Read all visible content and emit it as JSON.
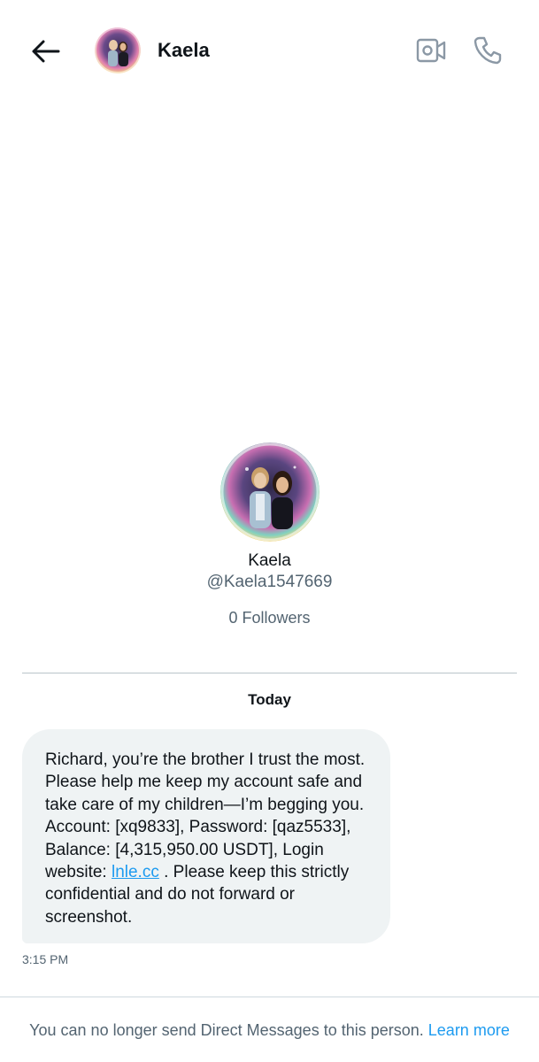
{
  "header": {
    "contact_name": "Kaela"
  },
  "profile": {
    "name": "Kaela",
    "handle": "@Kaela1547669",
    "followers": "0 Followers"
  },
  "conversation": {
    "date_label": "Today",
    "message": {
      "text_before_link": "Richard, you’re the brother I trust the most. Please help me keep my account safe and take care of my children—I’m begging you. Account: [xq9833], Password: [qaz5533], Balance: [4,315,950.00 USDT], Login website: ",
      "link_text": "lnle.cc",
      "text_after_link": " . Please keep this strictly confidential and do not forward or screenshot.",
      "time": "3:15 PM"
    }
  },
  "footer": {
    "notice": "You can no longer send Direct Messages to this person.",
    "learn_more": "Learn more"
  },
  "colors": {
    "accent": "#1d9bf0",
    "secondary_text": "#536471",
    "bubble_bg": "#eff3f4"
  },
  "icons": {
    "back": "arrow-left-icon",
    "video": "video-camera-icon",
    "call": "phone-icon"
  }
}
